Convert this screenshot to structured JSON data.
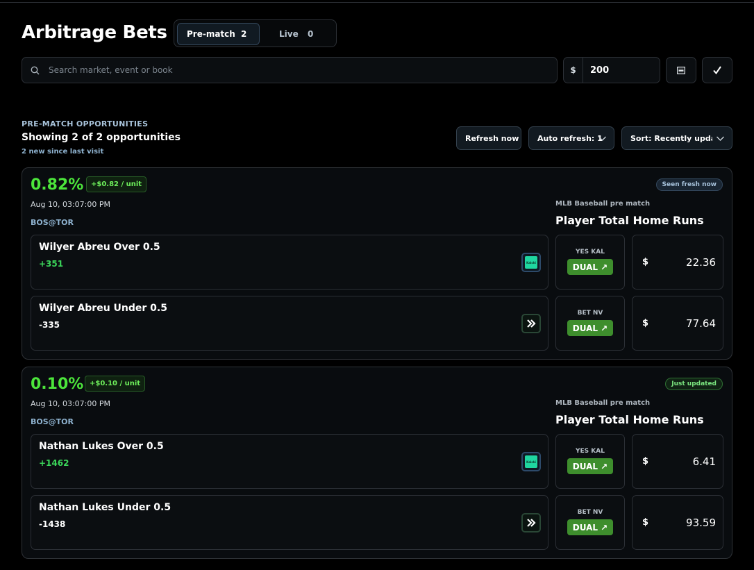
{
  "header": {
    "title": "Arbitrage Bets"
  },
  "tabs": [
    {
      "label": "Pre-match",
      "count": "2",
      "active": true
    },
    {
      "label": "Live",
      "count": "0",
      "active": false
    }
  ],
  "search": {
    "placeholder": "Search market, event or book",
    "value": ""
  },
  "stake": {
    "currency": "$",
    "value": "200"
  },
  "section": {
    "label": "PRE-MATCH OPPORTUNITIES",
    "title": "Showing 2 of 2 opportunities",
    "new_note": "2 new since last visit",
    "refresh_label": "Refresh now",
    "auto_refresh_label": "Auto refresh: 1",
    "sort_label": "Sort: Recently updated"
  },
  "cards": [
    {
      "profit_pct": "0.82%",
      "per_unit": "+$0.82 / unit",
      "status": "Seen fresh now",
      "time": "Aug 10, 03:07:00 PM",
      "event": "BOS@TOR",
      "league": "MLB Baseball pre match",
      "market": "Player Total Home Runs",
      "legs": [
        {
          "name": "Wilyer Abreu Over 0.5",
          "odds": "+351",
          "book_code": "YES KAL",
          "book_logo": "kalshi-logo",
          "action": "DUAL ↗",
          "currency": "$",
          "amount": "22.36"
        },
        {
          "name": "Wilyer Abreu Under 0.5",
          "odds": "-335",
          "book_code": "BET NV",
          "book_logo": "novig-logo",
          "action": "DUAL ↗",
          "currency": "$",
          "amount": "77.64"
        }
      ]
    },
    {
      "profit_pct": "0.10%",
      "per_unit": "+$0.10 / unit",
      "status": "Just updated",
      "time": "Aug 10, 03:07:00 PM",
      "event": "BOS@TOR",
      "league": "MLB Baseball pre match",
      "market": "Player Total Home Runs",
      "legs": [
        {
          "name": "Nathan Lukes Over 0.5",
          "odds": "+1462",
          "book_code": "YES KAL",
          "book_logo": "kalshi-logo",
          "action": "DUAL ↗",
          "currency": "$",
          "amount": "6.41"
        },
        {
          "name": "Nathan Lukes Under 0.5",
          "odds": "-1438",
          "book_code": "BET NV",
          "book_logo": "novig-logo",
          "action": "DUAL ↗",
          "currency": "$",
          "amount": "93.59"
        }
      ]
    }
  ],
  "colors": {
    "accent_green": "#4ce53b",
    "odds_positive": "#3bd65a",
    "action_green": "#3e8e2d",
    "link_blue": "#8fb3d0",
    "background": "#000000"
  },
  "icons": {
    "search": "search-icon",
    "list": "list-icon",
    "check": "check-icon",
    "chevron": "chevron-down-icon"
  }
}
